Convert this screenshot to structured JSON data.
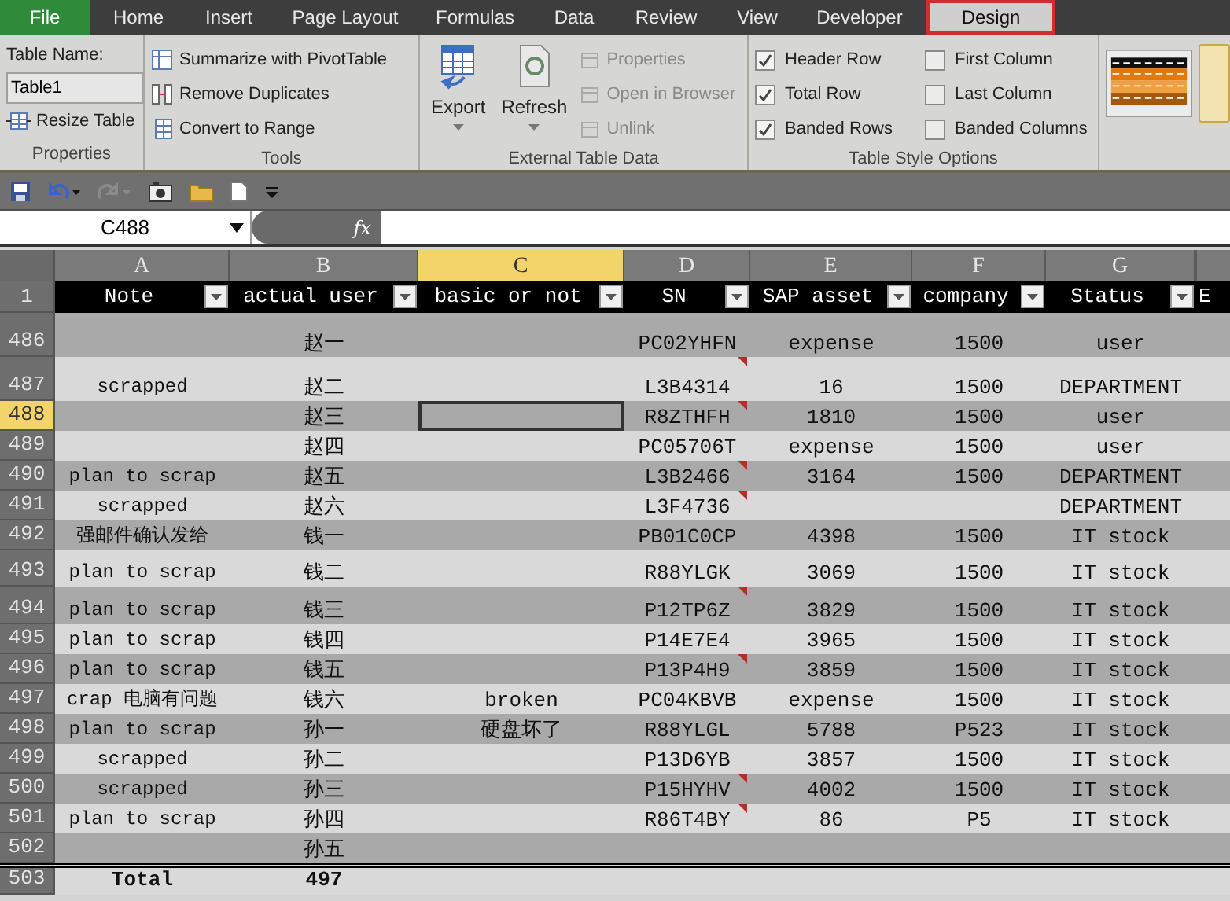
{
  "ribbon_tabs": [
    {
      "label": "File",
      "kind": "file",
      "selected": false
    },
    {
      "label": "Home",
      "kind": "tab",
      "selected": false
    },
    {
      "label": "Insert",
      "kind": "tab",
      "selected": false
    },
    {
      "label": "Page Layout",
      "kind": "tab",
      "selected": false
    },
    {
      "label": "Formulas",
      "kind": "tab",
      "selected": false
    },
    {
      "label": "Data",
      "kind": "tab",
      "selected": false
    },
    {
      "label": "Review",
      "kind": "tab",
      "selected": false
    },
    {
      "label": "View",
      "kind": "tab",
      "selected": false
    },
    {
      "label": "Developer",
      "kind": "tab",
      "selected": false
    },
    {
      "label": "Design",
      "kind": "tab",
      "selected": true
    }
  ],
  "ribbon": {
    "properties": {
      "table_name_label": "Table Name:",
      "table_name": "Table1",
      "resize_table": "Resize Table",
      "group_label": "Properties"
    },
    "tools": {
      "items": [
        "Summarize with PivotTable",
        "Remove Duplicates",
        "Convert to Range"
      ],
      "group_label": "Tools"
    },
    "external_table_data": {
      "large_buttons": [
        "Export",
        "Refresh"
      ],
      "items": [
        {
          "label": "Properties",
          "disabled": true
        },
        {
          "label": "Open in Browser",
          "disabled": true
        },
        {
          "label": "Unlink",
          "disabled": true
        }
      ],
      "group_label": "External Table Data"
    },
    "table_style_options": {
      "options": [
        {
          "label": "Header Row",
          "checked": true
        },
        {
          "label": "First Column",
          "checked": false
        },
        {
          "label": "Total Row",
          "checked": true
        },
        {
          "label": "Last Column",
          "checked": false
        },
        {
          "label": "Banded Rows",
          "checked": true
        },
        {
          "label": "Banded Columns",
          "checked": false
        }
      ],
      "group_label": "Table Style Options"
    }
  },
  "formula_bar": {
    "name_box": "C488",
    "function_label": "fx"
  },
  "sheet": {
    "columns": [
      {
        "letter": "A",
        "selected": false
      },
      {
        "letter": "B",
        "selected": false
      },
      {
        "letter": "C",
        "selected": true
      },
      {
        "letter": "D",
        "selected": false
      },
      {
        "letter": "E",
        "selected": false
      },
      {
        "letter": "F",
        "selected": false
      },
      {
        "letter": "G",
        "selected": false
      }
    ],
    "header_row": {
      "number": "1",
      "cells": [
        "Note",
        "actual user",
        "basic or not",
        "SN",
        "SAP asset",
        "company",
        "Status",
        "E"
      ]
    },
    "rows": [
      {
        "number": "486",
        "selected": false,
        "has_comment": false,
        "cells": [
          null,
          "赵一",
          null,
          "PC02YHFN",
          "expense",
          "1500",
          "user"
        ]
      },
      {
        "number": "487",
        "selected": false,
        "has_comment": true,
        "cells": [
          "scrapped",
          "赵二",
          null,
          "L3B4314",
          "16",
          "1500",
          "DEPARTMENT"
        ]
      },
      {
        "number": "488",
        "selected": true,
        "has_comment": true,
        "cells": [
          null,
          "赵三",
          null,
          "R8ZTHFH",
          "1810",
          "1500",
          "user"
        ]
      },
      {
        "number": "489",
        "selected": false,
        "has_comment": false,
        "cells": [
          null,
          "赵四",
          null,
          "PC05706T",
          "expense",
          "1500",
          "user"
        ]
      },
      {
        "number": "490",
        "selected": false,
        "has_comment": true,
        "cells": [
          "plan to scrap",
          "赵五",
          null,
          "L3B2466",
          "3164",
          "1500",
          "DEPARTMENT"
        ]
      },
      {
        "number": "491",
        "selected": false,
        "has_comment": true,
        "cells": [
          "scrapped",
          "赵六",
          null,
          "L3F4736",
          null,
          null,
          "DEPARTMENT"
        ]
      },
      {
        "number": "492",
        "selected": false,
        "has_comment": false,
        "cells": [
          "强邮件确认发给",
          "钱一",
          null,
          "PB01C0CP",
          "4398",
          "1500",
          "IT stock"
        ]
      },
      {
        "number": "493",
        "selected": false,
        "has_comment": false,
        "cells": [
          "plan to scrap",
          "钱二",
          null,
          "R88YLGK",
          "3069",
          "1500",
          "IT stock"
        ]
      },
      {
        "number": "494",
        "selected": false,
        "has_comment": true,
        "cells": [
          "plan to scrap",
          "钱三",
          null,
          "P12TP6Z",
          "3829",
          "1500",
          "IT stock"
        ]
      },
      {
        "number": "495",
        "selected": false,
        "has_comment": false,
        "cells": [
          "plan to scrap",
          "钱四",
          null,
          "P14E7E4",
          "3965",
          "1500",
          "IT stock"
        ]
      },
      {
        "number": "496",
        "selected": false,
        "has_comment": true,
        "cells": [
          "plan to scrap",
          "钱五",
          null,
          "P13P4H9",
          "3859",
          "1500",
          "IT stock"
        ]
      },
      {
        "number": "497",
        "selected": false,
        "has_comment": false,
        "cells": [
          "crap 电脑有问题",
          "钱六",
          "broken",
          "PC04KBVB",
          "expense",
          "1500",
          "IT stock"
        ]
      },
      {
        "number": "498",
        "selected": false,
        "has_comment": false,
        "cells": [
          "plan to scrap",
          "孙一",
          "硬盘坏了",
          "R88YLGL",
          "5788",
          "P523",
          "IT stock"
        ]
      },
      {
        "number": "499",
        "selected": false,
        "has_comment": false,
        "cells": [
          "scrapped",
          "孙二",
          null,
          "P13D6YB",
          "3857",
          "1500",
          "IT stock"
        ]
      },
      {
        "number": "500",
        "selected": false,
        "has_comment": true,
        "cells": [
          "scrapped",
          "孙三",
          null,
          "P15HYHV",
          "4002",
          "1500",
          "IT stock"
        ]
      },
      {
        "number": "501",
        "selected": false,
        "has_comment": true,
        "cells": [
          "plan to scrap",
          "孙四",
          null,
          "R86T4BY",
          "86",
          "P5",
          "IT stock"
        ]
      },
      {
        "number": "502",
        "selected": false,
        "has_comment": false,
        "cells": [
          null,
          "孙五",
          null,
          null,
          null,
          null,
          null
        ]
      }
    ],
    "total_row": {
      "number": "503",
      "cells": [
        "Total",
        "497"
      ]
    }
  }
}
